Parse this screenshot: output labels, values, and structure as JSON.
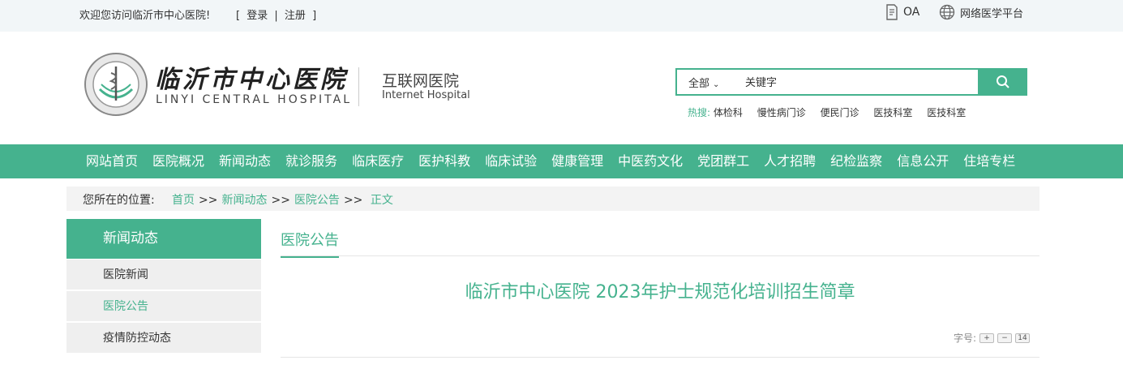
{
  "topbar": {
    "welcome": "欢迎您访问临沂市中心医院!",
    "bracket_open": "[",
    "login": "登录",
    "divider": "|",
    "register": "注册",
    "bracket_close": "]",
    "oa": "OA",
    "network_platform": "网络医学平台"
  },
  "header": {
    "logo_cn": "临沂市中心医院",
    "logo_en": "LINYI CENTRAL HOSPITAL",
    "internet_cn": "互联网医院",
    "internet_en": "Internet Hospital"
  },
  "search": {
    "scope": "全部",
    "placeholder": "关键字",
    "hot_label": "热搜:",
    "hot_items": [
      "体检科",
      "慢性病门诊",
      "便民门诊",
      "医技科室",
      "医技科室"
    ]
  },
  "nav": {
    "items": [
      "网站首页",
      "医院概况",
      "新闻动态",
      "就诊服务",
      "临床医疗",
      "医护科教",
      "临床试验",
      "健康管理",
      "中医药文化",
      "党团群工",
      "人才招聘",
      "纪检监察",
      "信息公开",
      "住培专栏"
    ]
  },
  "breadcrumb": {
    "label": "您所在的位置:",
    "home": "首页",
    "news": "新闻动态",
    "notice": "医院公告",
    "current": "正文",
    "sep": ">>"
  },
  "sidebar": {
    "title": "新闻动态",
    "items": [
      "医院新闻",
      "医院公告",
      "疫情防控动态"
    ]
  },
  "content": {
    "tab": "医院公告",
    "article_title": "临沂市中心医院 2023年护士规范化培训招生简章",
    "font_label": "字号:",
    "font_plus": "+",
    "font_minus": "−",
    "font_size": "14"
  },
  "colors": {
    "accent": "#45b28e",
    "topbar_bg": "#f2f6f8",
    "sidebar_item_bg": "#efefef"
  }
}
